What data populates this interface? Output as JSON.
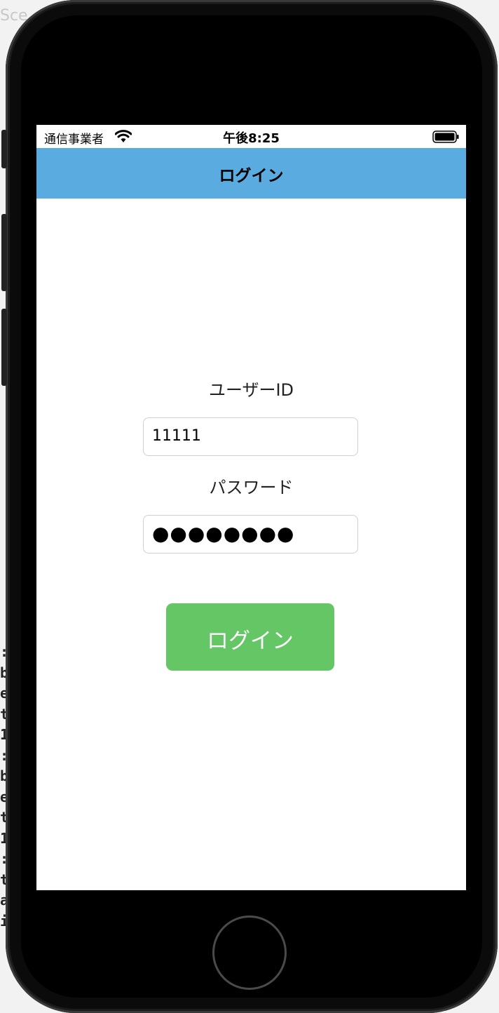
{
  "backdrop": {
    "title": "Sce",
    "fragments": ":\nb\ne\nt\n1\n:\nb\ne\nt\n1\n:\nt\na\ni"
  },
  "status_bar": {
    "carrier": "通信事業者",
    "time": "午後8:25",
    "icons": [
      "wifi-icon",
      "battery-icon"
    ]
  },
  "nav": {
    "title": "ログイン"
  },
  "form": {
    "user_id_label": "ユーザーID",
    "user_id_value": "11111",
    "password_label": "パスワード",
    "password_value": "●●●●●●●●",
    "login_button_label": "ログイン"
  },
  "colors": {
    "nav_bar": "#5aabe0",
    "login_button": "#65c666",
    "field_border": "#cfcfcf"
  }
}
